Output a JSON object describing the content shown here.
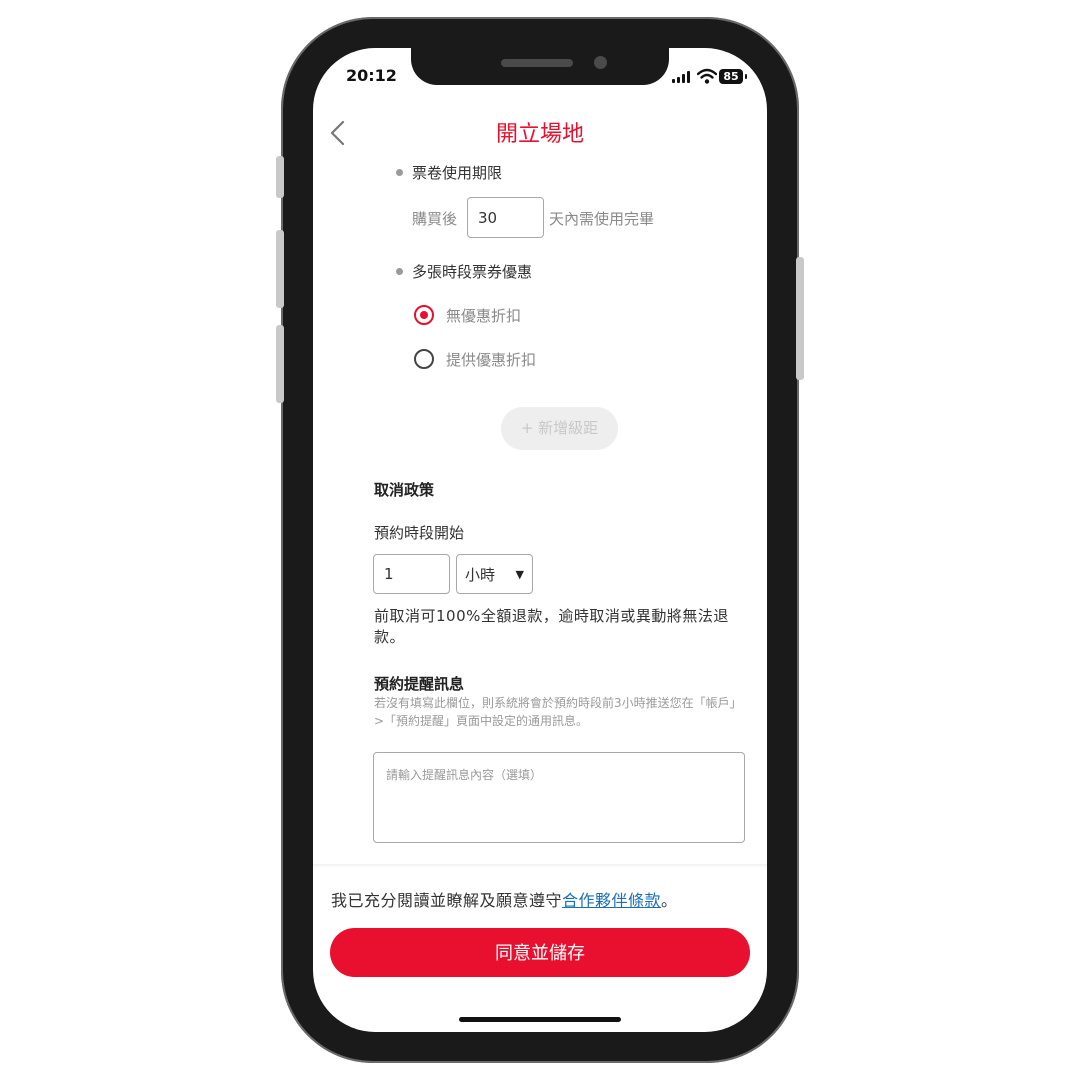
{
  "status_bar": {
    "time": "20:12",
    "battery": "85"
  },
  "header": {
    "title": "開立場地"
  },
  "ticket_validity": {
    "label": "票卷使用期限",
    "prefix": "購買後",
    "days_value": "30",
    "suffix": "天內需使用完畢"
  },
  "multi_ticket": {
    "label": "多張時段票券優惠",
    "options": [
      {
        "label": "無優惠折扣",
        "selected": true
      },
      {
        "label": "提供優惠折扣",
        "selected": false
      }
    ],
    "add_tier_label": "+ 新增級距"
  },
  "cancel_policy": {
    "heading": "取消政策",
    "start_label": "預約時段開始",
    "amount_value": "1",
    "unit_selected": "小時",
    "note": "前取消可100%全額退款，逾時取消或異動將無法退款。"
  },
  "reminder": {
    "heading": "預約提醒訊息",
    "description": "若沒有填寫此欄位，則系統將會於預約時段前3小時推送您在「帳戶」>「預約提醒」頁面中設定的通用訊息。",
    "placeholder": "請輸入提醒訊息內容（選填）"
  },
  "footer": {
    "agree_prefix": "我已充分閱讀並瞭解及願意遵守",
    "agree_link": "合作夥伴條款",
    "agree_suffix": "。",
    "save_label": "同意並儲存"
  },
  "colors": {
    "accent": "#e8102e",
    "link": "#1a6fb5"
  }
}
